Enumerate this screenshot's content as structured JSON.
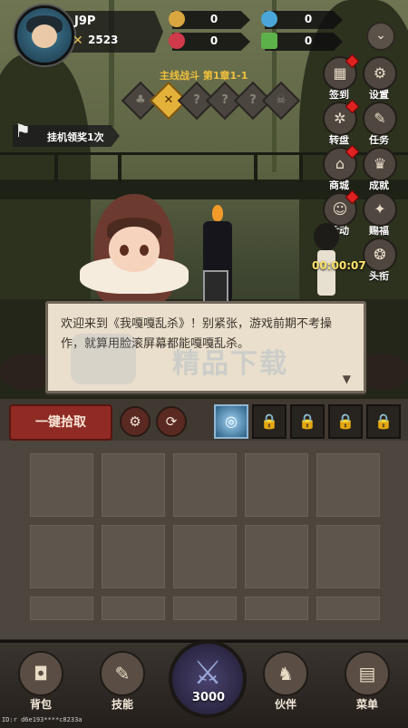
{
  "player": {
    "name": "J9P",
    "power": "2523"
  },
  "resources": [
    {
      "icon": "gold-coin-icon",
      "value": "0",
      "color": "#d9a640"
    },
    {
      "icon": "blue-gem-icon",
      "value": "0",
      "color": "#4aa6d8"
    },
    {
      "icon": "red-gem-icon",
      "value": "0",
      "color": "#d13a4a"
    },
    {
      "icon": "green-cash-icon",
      "value": "0",
      "color": "#5db14a"
    }
  ],
  "side_buttons": [
    {
      "label": "签到",
      "icon": "calendar-icon",
      "badge": true
    },
    {
      "label": "设置",
      "icon": "gear-icon",
      "badge": false
    },
    {
      "label": "转盘",
      "icon": "wheel-icon",
      "badge": true
    },
    {
      "label": "任务",
      "icon": "scroll-icon",
      "badge": false
    },
    {
      "label": "商城",
      "icon": "shop-icon",
      "badge": true
    },
    {
      "label": "成就",
      "icon": "trophy-icon",
      "badge": false
    },
    {
      "label": "活动",
      "icon": "event-icon",
      "badge": true
    },
    {
      "label": "赐福",
      "icon": "blessing-icon",
      "badge": false
    },
    {
      "label": "头衔",
      "icon": "title-icon",
      "badge": false
    }
  ],
  "stage": {
    "title": "主线战斗 第1章1-1",
    "nodes": [
      "♣",
      "✕",
      "?",
      "?",
      "?",
      "☠"
    ]
  },
  "afk": {
    "label": "挂机领奖1次"
  },
  "timer": "00:00:07",
  "dialog": {
    "text": "欢迎来到《我嘎嘎乱杀》！别紧张，游戏前期不考操作，就算用脸滚屏幕都能嘎嘎乱杀。"
  },
  "watermark": "精品下载",
  "toolbar": {
    "pick_all": "一键拾取",
    "settings_glyph": "⚙",
    "refresh_glyph": "⟳",
    "lock_glyph": "🔒"
  },
  "nav": {
    "bag": "背包",
    "skills": "技能",
    "battle_value": "3000",
    "partner": "伙伴",
    "menu": "菜单"
  },
  "device_id": "ID:r d6e193****c8233a",
  "colors": {
    "accent_gold": "#e4b23a",
    "pick_red": "#8f2a24",
    "panel": "#4d463e"
  }
}
